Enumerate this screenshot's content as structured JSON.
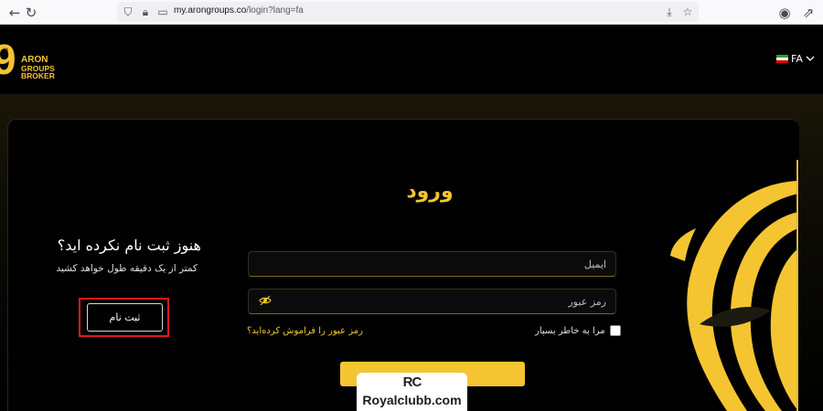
{
  "browser": {
    "url_host": "my.arongroups.co",
    "url_path": "/login?lang=fa"
  },
  "header": {
    "logo_lines": [
      "ARON",
      "GROUPS",
      "BROKER"
    ],
    "language": "FA"
  },
  "login": {
    "title": "ورود",
    "email_placeholder": "ایمیل",
    "password_placeholder": "رمز عبور",
    "remember_label": "مرا به خاطر بسپار",
    "forgot_link": "رمز عبور را فراموش کرده‌اید؟",
    "submit_label": "ورود"
  },
  "register": {
    "heading": "هنوز ثبت نام نکرده اید؟",
    "subtitle": "کمتر از یک دقیقه طول خواهد کشید",
    "button_label": "ثبت نام"
  },
  "watermark": {
    "mark": "RC",
    "text": "Royalclubb.com"
  },
  "colors": {
    "accent": "#f4c531",
    "highlight": "#e01919",
    "background": "#000000"
  },
  "icons": [
    "reload-icon",
    "shield-icon",
    "lock-icon",
    "page-icon",
    "download-icon",
    "star-icon",
    "account-icon",
    "extensions-icon",
    "eye-icon",
    "chevron-down-icon"
  ]
}
